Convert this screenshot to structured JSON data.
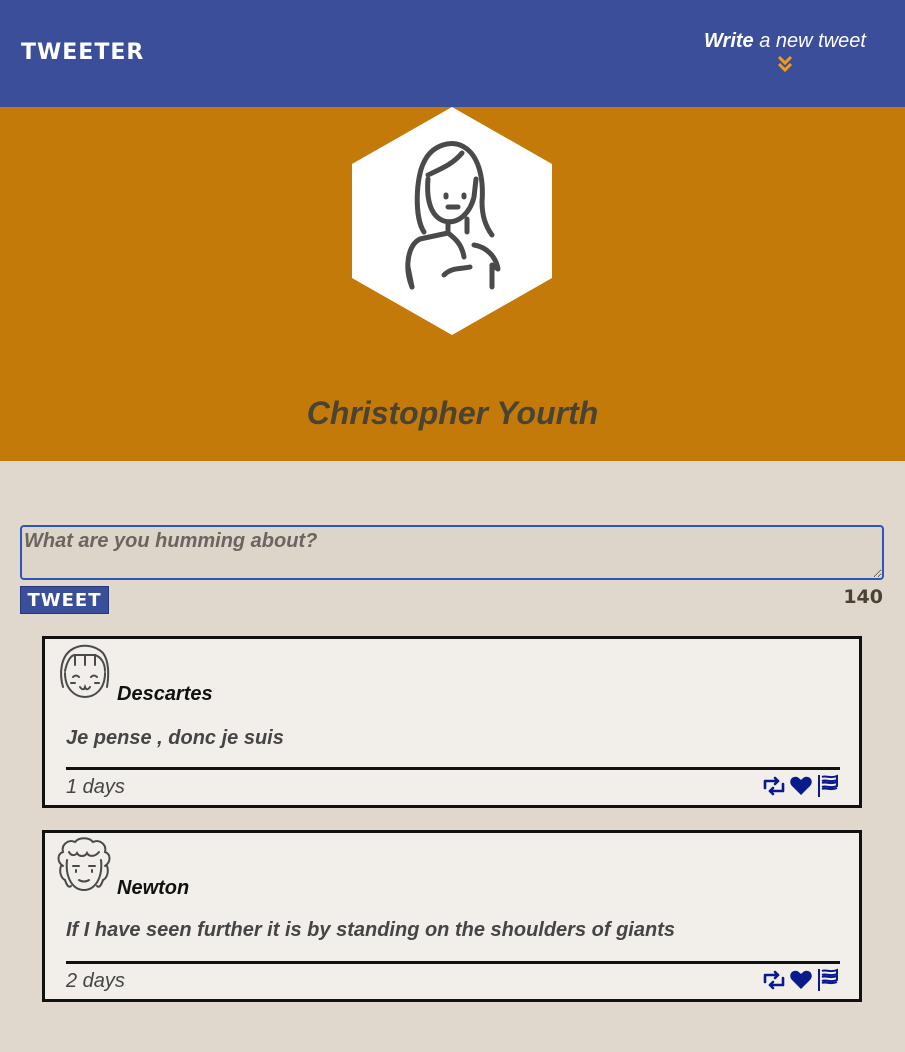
{
  "nav": {
    "brand": "Tweeter",
    "compose_strong": "Write",
    "compose_rest": " a new tweet"
  },
  "profile": {
    "name": "Christopher Yourth"
  },
  "compose": {
    "placeholder": "What are you humming about?",
    "button_label": "Tweet",
    "counter": "140"
  },
  "tweets": [
    {
      "handle": "Descartes",
      "text": "Je pense , donc je suis",
      "time": "1 days"
    },
    {
      "handle": "Newton",
      "text": "If I have seen further it is by standing on the shoulders of giants",
      "time": "2 days"
    }
  ],
  "icons": {
    "retweet": "retweet-icon",
    "like": "heart-icon",
    "flag": "flag-icon",
    "toggle": "double-chevron-down-icon"
  },
  "colors": {
    "nav": "#3a4e9a",
    "profile": "#c37a08",
    "background": "#e1d8cd",
    "accent": "#f39c12",
    "action_icons": "#0a1a8c"
  }
}
